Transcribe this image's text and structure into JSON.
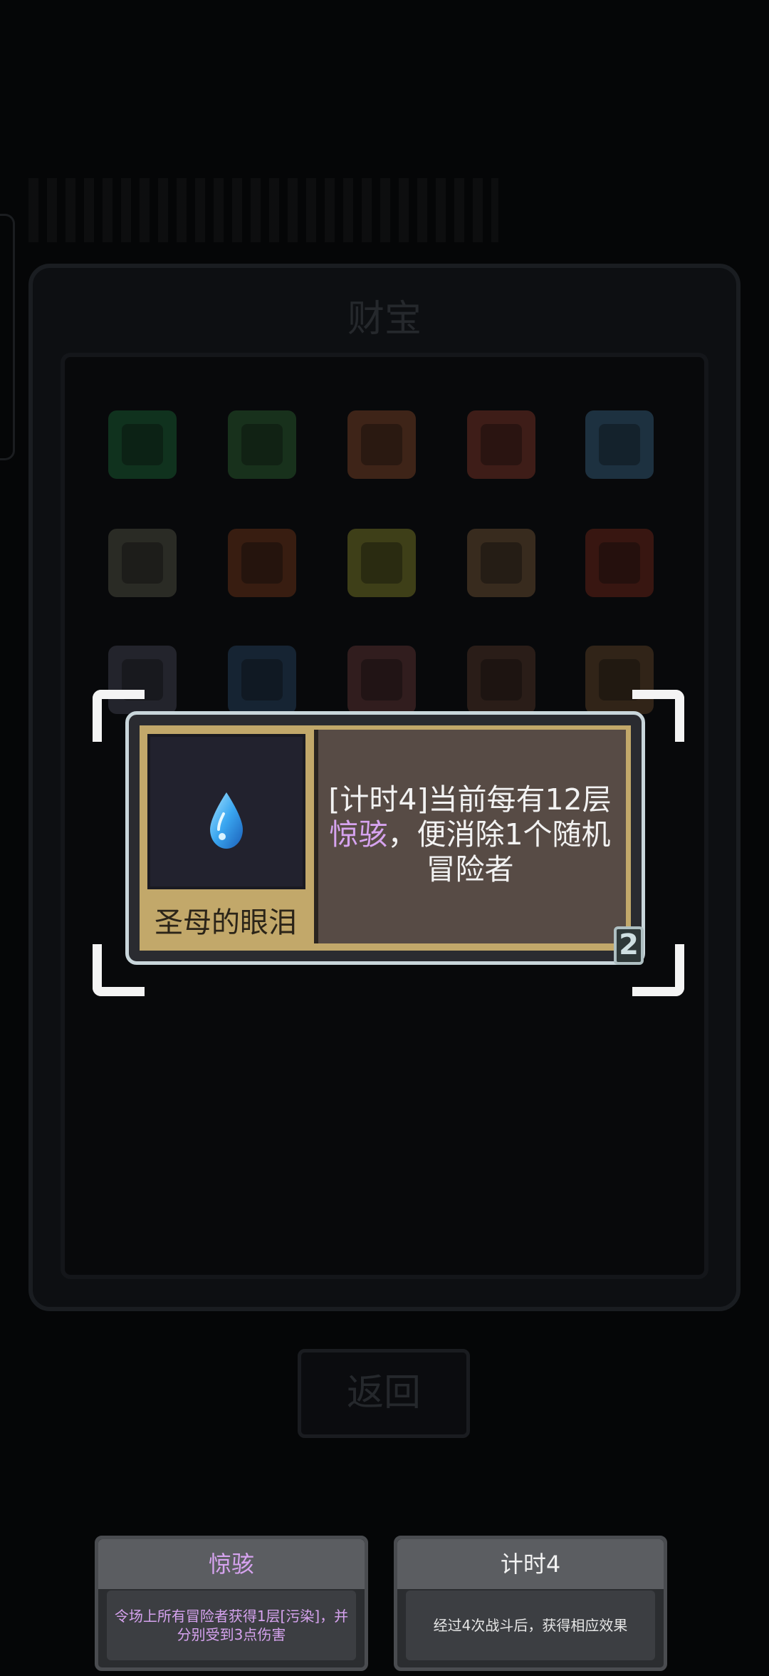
{
  "treasure_panel": {
    "title": "财宝",
    "relics": [
      {
        "name": "gem-relic-icon",
        "color": "#1c6b3a"
      },
      {
        "name": "figure-relic-icon",
        "color": "#2e6a34"
      },
      {
        "name": "shield-relic-icon",
        "color": "#8a4a2a"
      },
      {
        "name": "lion-relic-icon",
        "color": "#8a3a2a"
      },
      {
        "name": "molecule-relic-icon",
        "color": "#3a6a8a"
      },
      {
        "name": "box-relic-icon",
        "color": "#5a5a4a"
      },
      {
        "name": "chest-relic-icon",
        "color": "#7a3a1a"
      },
      {
        "name": "potion-relic-icon",
        "color": "#8a8a2a"
      },
      {
        "name": "toilet-relic-icon",
        "color": "#7a5a3a"
      },
      {
        "name": "flower-relic-icon",
        "color": "#7a2a1a"
      },
      {
        "name": "jar-relic-icon",
        "color": "#4a4a5a"
      },
      {
        "name": "tear-drop-relic-icon",
        "color": "#2a4a6a"
      },
      {
        "name": "bone-relic-icon",
        "color": "#6a3a3a"
      },
      {
        "name": "pot-relic-icon",
        "color": "#5a3a2a"
      },
      {
        "name": "diamond-relic-icon",
        "color": "#6a4a2a"
      }
    ]
  },
  "back_button": {
    "label": "返回"
  },
  "item_card": {
    "name": "圣母的眼泪",
    "desc_line1": "[计时4]当前每有12层",
    "desc_kw": "惊骇",
    "desc_line2_rest": "，便消除1个随机",
    "desc_line3": "冒险者",
    "tier": "2",
    "icon": "tear-drop-icon"
  },
  "keywords": [
    {
      "title": "惊骇",
      "color": "#d6a3ef",
      "desc": "令场上所有冒险者获得1层[污染]，并分别受到3点伤害"
    },
    {
      "title": "计时4",
      "color": "#f2f2f2",
      "desc": "经过4次战斗后，获得相应效果"
    }
  ],
  "colors": {
    "purple_keyword": "#d6a3ef",
    "card_gold": "#c2a86a",
    "card_brown": "#574b45"
  }
}
